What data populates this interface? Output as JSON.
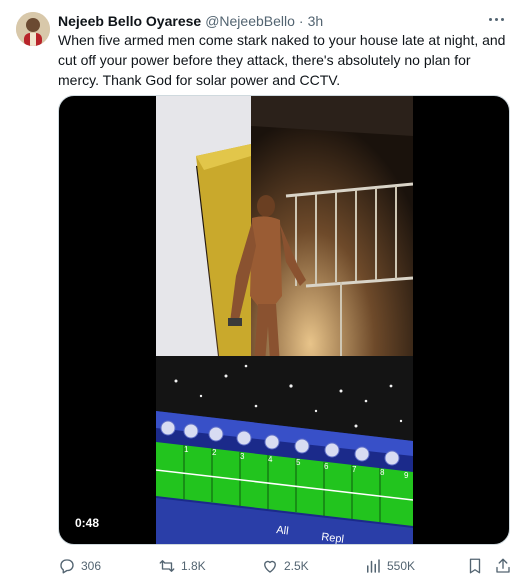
{
  "tweet": {
    "author_name": "Nejeeb Bello Oyarese",
    "handle": "@NejeebBello",
    "separator": "·",
    "time": "3h",
    "text": "When five armed men come stark naked to your house late at night, and cut off your power before they attack, there's absolutely no plan for mercy. Thank God for solar power and CCTV."
  },
  "media": {
    "duration": "0:48",
    "screen_labels": [
      "All",
      "Repl"
    ],
    "screen_numbers": [
      "1",
      "2",
      "3",
      "4",
      "5",
      "6",
      "7",
      "8",
      "9"
    ]
  },
  "actions": {
    "replies": "306",
    "reposts": "1.8K",
    "likes": "2.5K",
    "views": "550K"
  },
  "icons": [
    "more-options-icon",
    "reply-icon",
    "repost-icon",
    "like-icon",
    "views-icon",
    "bookmark-icon",
    "share-icon"
  ],
  "colors": {
    "text": "#0f1419",
    "secondary": "#536471",
    "border": "#cfd9de"
  }
}
